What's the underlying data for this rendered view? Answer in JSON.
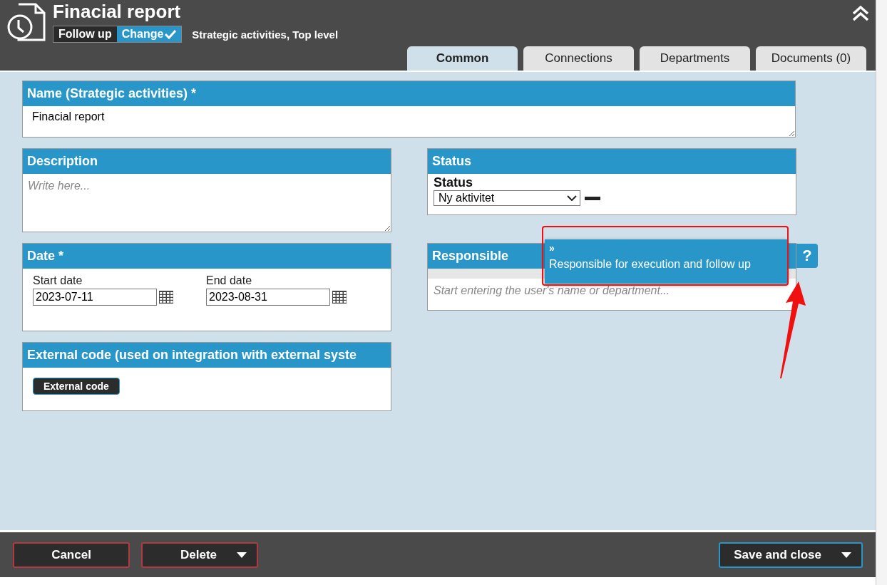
{
  "header": {
    "title": "Finacial report",
    "modes": [
      {
        "label": "Follow up",
        "selected": false
      },
      {
        "label": "Change",
        "selected": true
      }
    ],
    "context": "Strategic activities, Top level"
  },
  "tabs": [
    {
      "label": "Common",
      "selected": true
    },
    {
      "label": "Connections",
      "selected": false
    },
    {
      "label": "Departments",
      "selected": false
    },
    {
      "label": "Documents (0)",
      "selected": false
    }
  ],
  "name": {
    "title": "Name (Strategic activities) *",
    "value": "Finacial report"
  },
  "description": {
    "title": "Description",
    "placeholder": "Write here..."
  },
  "date": {
    "title": "Date *",
    "start_label": "Start date",
    "start_value": "2023-07-11",
    "end_label": "End date",
    "end_value": "2023-08-31"
  },
  "external": {
    "title": "External code (used on integration with external syste",
    "button": "External code"
  },
  "status": {
    "title": "Status",
    "label": "Status",
    "value": "Ny aktivitet"
  },
  "responsible": {
    "title": "Responsible",
    "placeholder": "Start entering the user's name or department...",
    "help": "?",
    "tooltip": {
      "marker": "»",
      "text": "Responsible for execution and follow up"
    }
  },
  "footer": {
    "cancel": "Cancel",
    "delete": "Delete",
    "save": "Save and close"
  }
}
